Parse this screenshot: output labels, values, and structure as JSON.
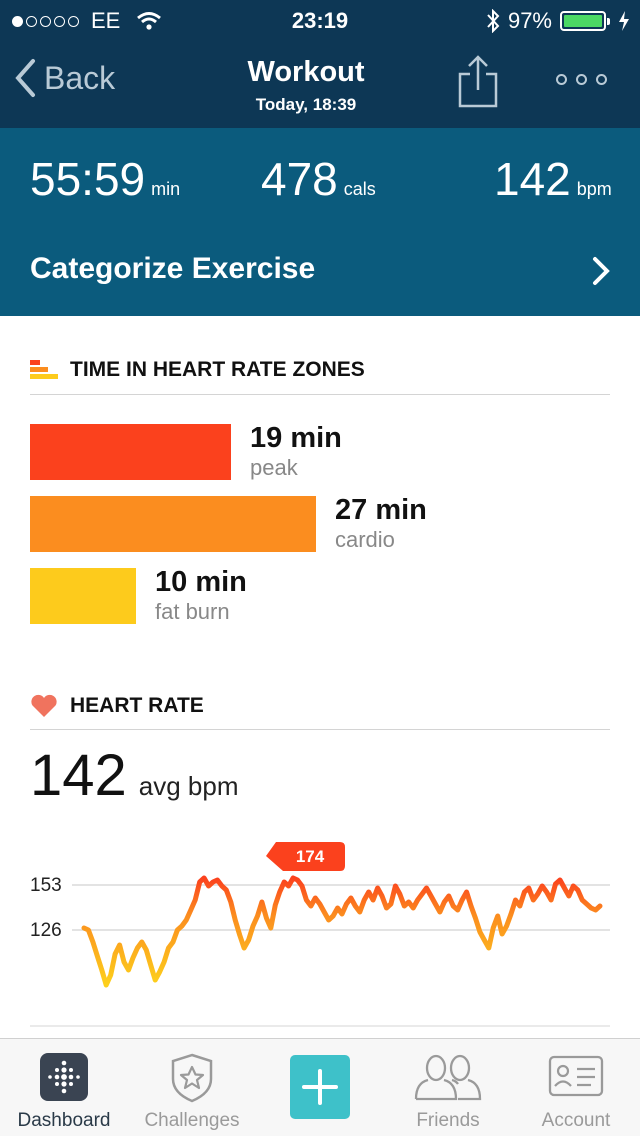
{
  "status": {
    "carrier": "EE",
    "time": "23:19",
    "battery": "97%"
  },
  "nav": {
    "back_label": "Back",
    "title": "Workout",
    "subtitle": "Today, 18:39"
  },
  "summary": {
    "duration": {
      "value": "55:59",
      "unit": "min"
    },
    "calories": {
      "value": "478",
      "unit": "cals"
    },
    "heart": {
      "value": "142",
      "unit": "bpm"
    },
    "categorize_label": "Categorize Exercise"
  },
  "zones": {
    "title": "TIME IN HEART RATE ZONES",
    "items": [
      {
        "value": "19 min",
        "label": "peak",
        "minutes": 19,
        "color": "#fb411d"
      },
      {
        "value": "27 min",
        "label": "cardio",
        "minutes": 27,
        "color": "#fb8d1f"
      },
      {
        "value": "10 min",
        "label": "fat burn",
        "minutes": 10,
        "color": "#fdcb1c"
      }
    ]
  },
  "heart_rate": {
    "title": "HEART RATE",
    "avg_value": "142",
    "avg_label": "avg bpm",
    "peak_marker": "174",
    "gridlines": [
      "153",
      "126"
    ]
  },
  "colors": {
    "nav_bg": "#0d3755",
    "summary_bg": "#0b5b7d",
    "accent_plus": "#3ec1c9",
    "heart_icon": "#f0735e"
  },
  "tabs": [
    {
      "label": "Dashboard",
      "icon": "dashboard-icon",
      "active": true
    },
    {
      "label": "Challenges",
      "icon": "challenges-star-badge-icon",
      "active": false
    },
    {
      "label": "",
      "icon": "plus-icon",
      "active": false
    },
    {
      "label": "Friends",
      "icon": "friends-icon",
      "active": false
    },
    {
      "label": "Account",
      "icon": "account-card-icon",
      "active": false
    }
  ]
}
